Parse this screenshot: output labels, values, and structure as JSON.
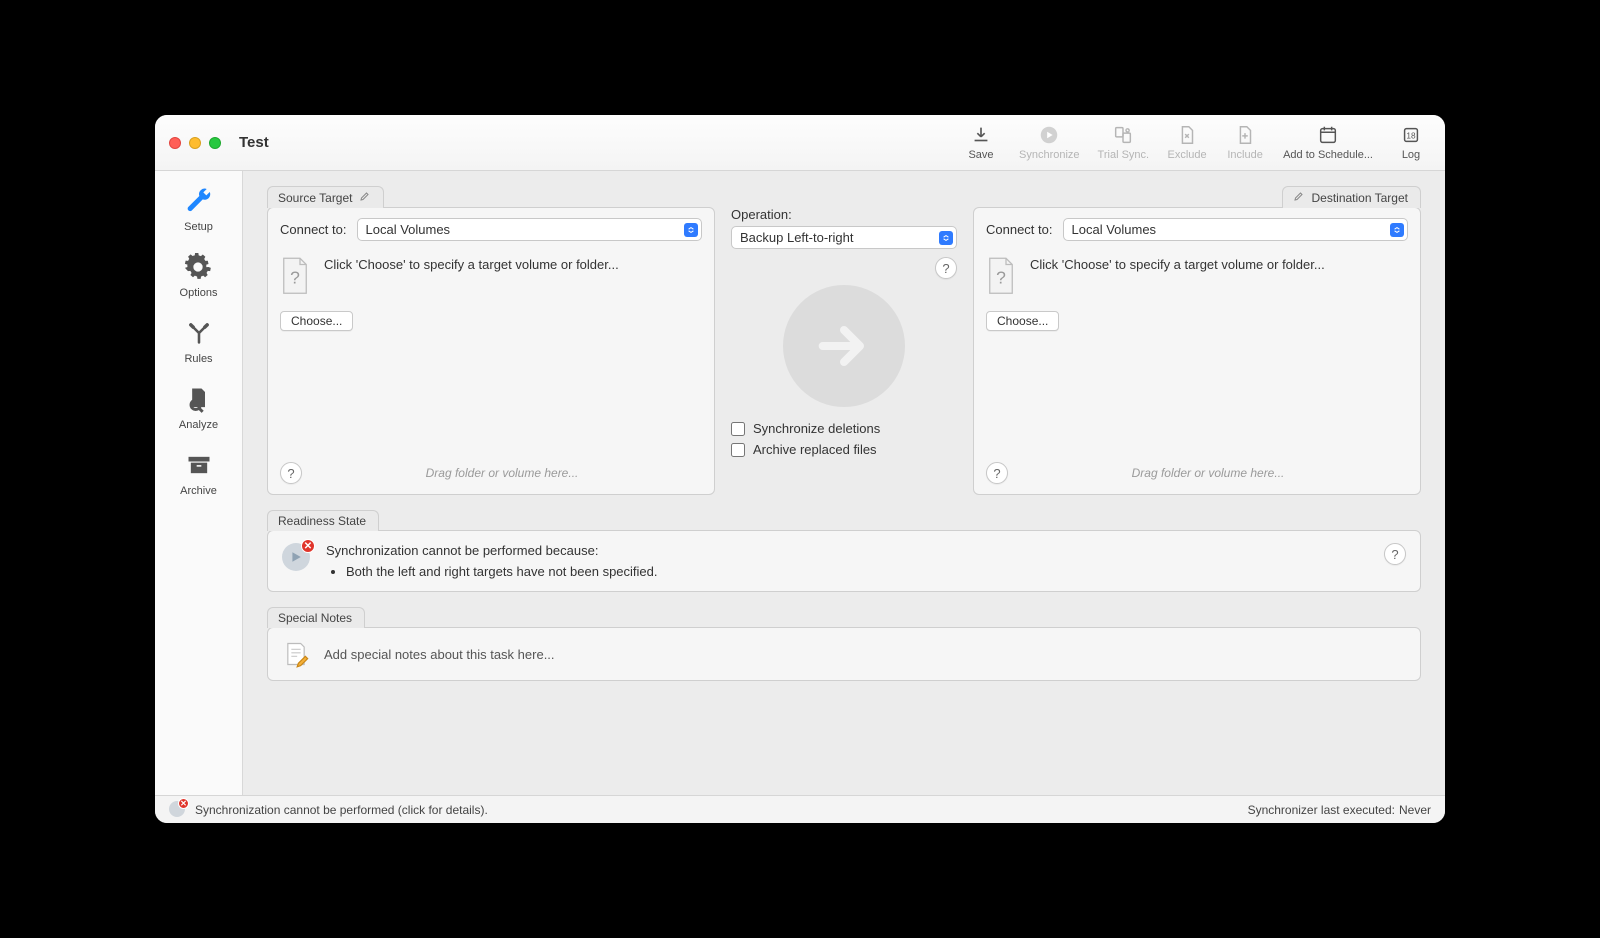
{
  "window": {
    "title": "Test"
  },
  "toolbar": {
    "save": "Save",
    "synchronize": "Synchronize",
    "trial_sync": "Trial Sync.",
    "exclude": "Exclude",
    "include": "Include",
    "add_to_schedule": "Add to Schedule...",
    "log": "Log"
  },
  "sidebar": {
    "setup": "Setup",
    "options": "Options",
    "rules": "Rules",
    "analyze": "Analyze",
    "archive": "Archive"
  },
  "source": {
    "tab": "Source Target",
    "connect_label": "Connect to:",
    "connect_value": "Local Volumes",
    "placeholder": "Click 'Choose' to specify a target volume or folder...",
    "choose": "Choose...",
    "drag_hint": "Drag folder or volume here..."
  },
  "destination": {
    "tab": "Destination Target",
    "connect_label": "Connect to:",
    "connect_value": "Local Volumes",
    "placeholder": "Click 'Choose' to specify a target volume or folder...",
    "choose": "Choose...",
    "drag_hint": "Drag folder or volume here..."
  },
  "operation": {
    "label": "Operation:",
    "value": "Backup Left-to-right",
    "check_sync_del": "Synchronize deletions",
    "check_archive": "Archive replaced files"
  },
  "readiness": {
    "tab": "Readiness State",
    "message": "Synchronization cannot be performed because:",
    "bullet1": "Both the left and right targets have not been specified."
  },
  "notes": {
    "tab": "Special Notes",
    "placeholder": "Add special notes about this task here..."
  },
  "status": {
    "message": "Synchronization cannot be performed (click for details).",
    "last_exec_label": "Synchronizer last executed:",
    "last_exec_value": "Never"
  },
  "help_glyph": "?"
}
